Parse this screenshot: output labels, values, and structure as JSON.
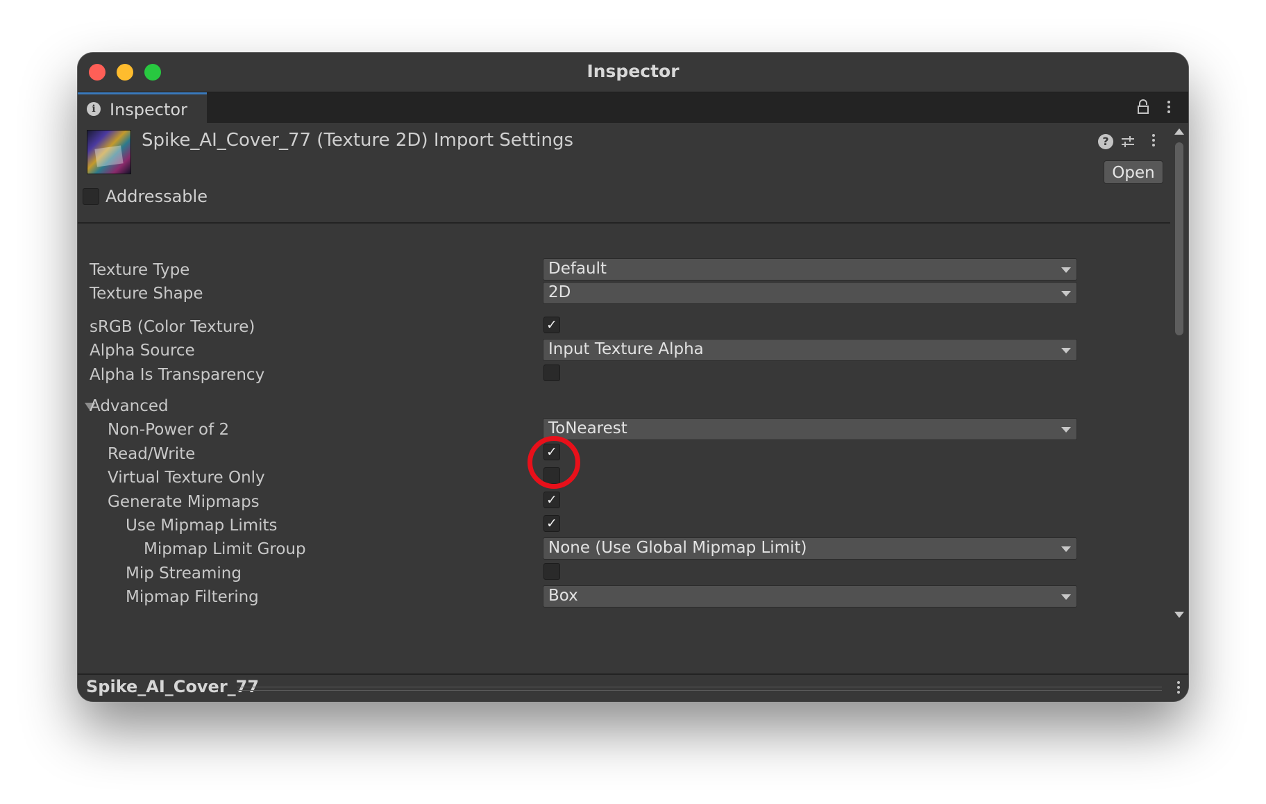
{
  "window": {
    "title": "Inspector"
  },
  "tab": {
    "label": "Inspector"
  },
  "header": {
    "asset_title": "Spike_AI_Cover_77 (Texture 2D) Import Settings",
    "open_label": "Open",
    "addressable_label": "Addressable",
    "addressable_checked": false
  },
  "settings": {
    "texture_type": {
      "label": "Texture Type",
      "value": "Default"
    },
    "texture_shape": {
      "label": "Texture Shape",
      "value": "2D"
    },
    "srgb": {
      "label": "sRGB (Color Texture)",
      "checked": true
    },
    "alpha_source": {
      "label": "Alpha Source",
      "value": "Input Texture Alpha"
    },
    "alpha_is_transparency": {
      "label": "Alpha Is Transparency",
      "checked": false
    },
    "advanced": {
      "label": "Advanced",
      "expanded": true
    },
    "non_power_of_2": {
      "label": "Non-Power of 2",
      "value": "ToNearest"
    },
    "read_write": {
      "label": "Read/Write",
      "checked": true
    },
    "virtual_texture_only": {
      "label": "Virtual Texture Only",
      "checked": false
    },
    "generate_mipmaps": {
      "label": "Generate Mipmaps",
      "checked": true
    },
    "use_mipmap_limits": {
      "label": "Use Mipmap Limits",
      "checked": true
    },
    "mipmap_limit_group": {
      "label": "Mipmap Limit Group",
      "value": "None (Use Global Mipmap Limit)"
    },
    "mip_streaming": {
      "label": "Mip Streaming",
      "checked": false
    },
    "mipmap_filtering": {
      "label": "Mipmap Filtering",
      "value": "Box"
    }
  },
  "footer": {
    "asset_name": "Spike_AI_Cover_77"
  },
  "icons": {
    "info": "info-icon",
    "lock": "lock-icon",
    "menu": "kebab-menu-icon",
    "help": "help-icon",
    "presets": "sliders-icon",
    "check": "✓"
  },
  "colors": {
    "panel_bg": "#383838",
    "tab_bar_bg": "#232323",
    "field_bg": "#515151",
    "tab_accent": "#3a79bb",
    "annotation_red": "#e8101a"
  }
}
